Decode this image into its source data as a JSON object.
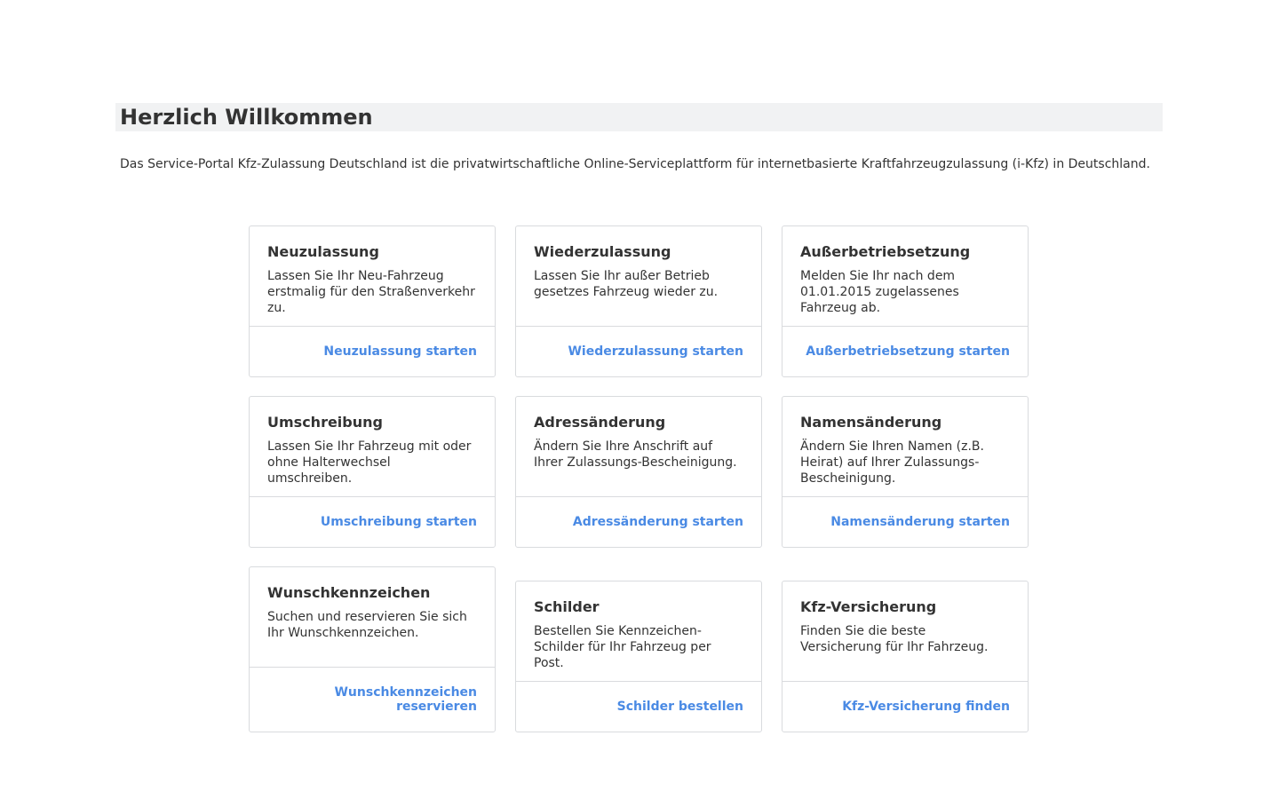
{
  "header": {
    "title": "Herzlich Willkommen"
  },
  "intro": {
    "text": "Das Service-Portal Kfz-Zulassung Deutschland ist die privatwirtschaftliche Online-Serviceplattform für internetbasierte Kraftfahrzeugzulassung (i-Kfz) in Deutschland."
  },
  "services": [
    {
      "title": "Neuzulassung",
      "description": "Lassen Sie Ihr Neu-Fahrzeug erstmalig für den Straßenverkehr zu.",
      "link": "Neuzulassung starten"
    },
    {
      "title": "Wiederzulassung",
      "description": "Lassen Sie Ihr außer Betrieb gesetzes Fahrzeug wieder zu.",
      "link": "Wiederzulassung starten"
    },
    {
      "title": "Außerbetriebsetzung",
      "description": "Melden Sie Ihr nach dem 01.01.2015 zugelassenes Fahrzeug ab.",
      "link": "Außerbetriebsetzung starten"
    },
    {
      "title": "Umschreibung",
      "description": "Lassen Sie Ihr Fahrzeug mit oder ohne Halterwechsel umschreiben.",
      "link": "Umschreibung starten"
    },
    {
      "title": "Adressänderung",
      "description": "Ändern Sie Ihre Anschrift auf Ihrer Zulassungs-Bescheinigung.",
      "link": "Adressänderung starten"
    },
    {
      "title": "Namensänderung",
      "description": "Ändern Sie Ihren Namen (z.B. Heirat) auf Ihrer Zulassungs-Bescheinigung.",
      "link": "Namensänderung starten"
    },
    {
      "title": "Wunschkennzeichen",
      "description": "Suchen und reservieren Sie sich Ihr Wunschkennzeichen.",
      "link": "Wunschkennzeichen reservieren"
    },
    {
      "title": "Schilder",
      "description": "Bestellen Sie Kennzeichen-Schilder für Ihr Fahrzeug per Post.",
      "link": "Schilder bestellen"
    },
    {
      "title": "Kfz-Versicherung",
      "description": "Finden Sie die beste Versicherung für Ihr Fahrzeug.",
      "link": "Kfz-Versicherung finden"
    }
  ],
  "colors": {
    "link": "#4a8ae4",
    "text": "#333333",
    "border": "#d9dbde",
    "heading_background": "#f1f2f3"
  }
}
